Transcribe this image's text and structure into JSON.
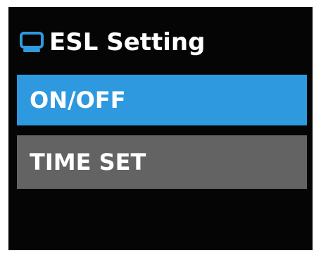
{
  "header": {
    "title": "ESL Setting",
    "icon": "monitor-icon"
  },
  "menu": {
    "items": [
      {
        "label": "ON/OFF",
        "selected": true
      },
      {
        "label": "TIME SET",
        "selected": false
      }
    ]
  },
  "colors": {
    "background": "#050505",
    "selected": "#2e99de",
    "item": "#636363",
    "icon": "#2e99de",
    "text": "#ffffff"
  }
}
